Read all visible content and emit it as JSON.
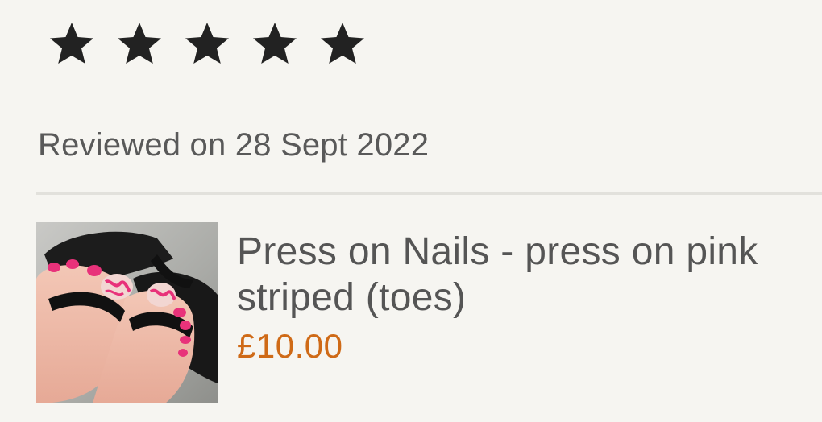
{
  "review": {
    "rating": 5,
    "rating_max": 5,
    "star_icon": "star-icon",
    "star_color": "#222222",
    "reviewed_text": "Reviewed on 28 Sept 2022"
  },
  "product": {
    "title": "Press on Nails - press on pink striped (toes)",
    "price": "£10.00",
    "price_color": "#cf6a17",
    "thumbnail_icon": "product-thumbnail"
  }
}
